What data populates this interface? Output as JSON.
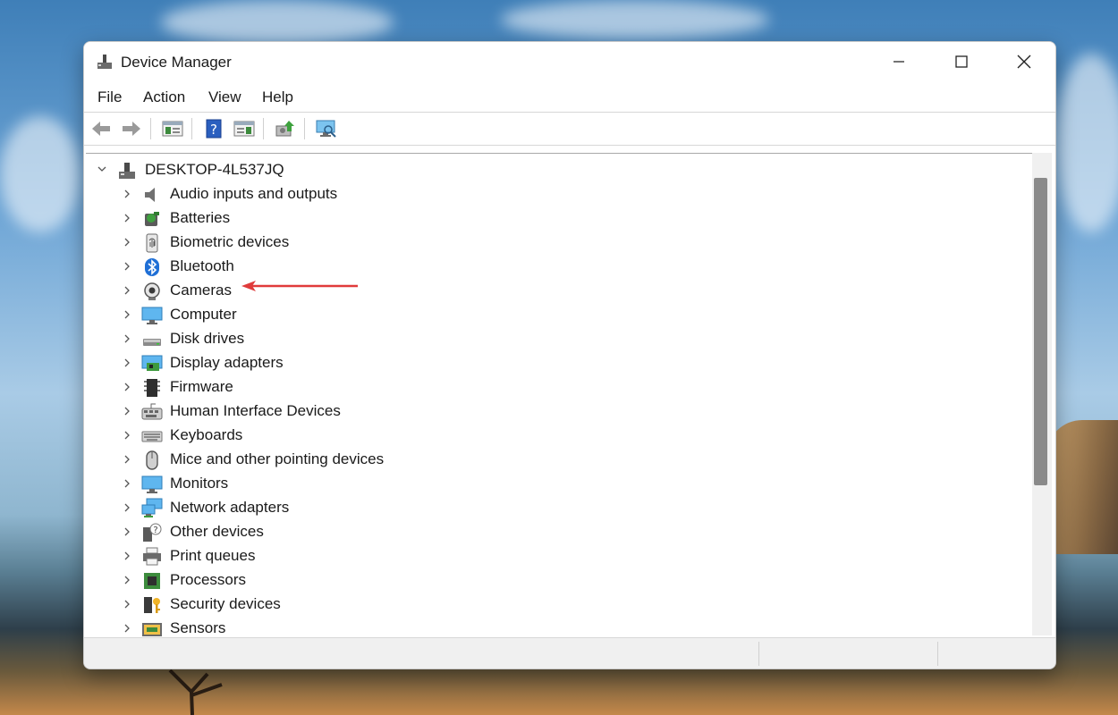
{
  "window": {
    "title": "Device Manager",
    "controls": {
      "minimize": "minimize-icon",
      "maximize": "maximize-icon",
      "close": "close-icon"
    }
  },
  "menu": [
    "File",
    "Action",
    "View",
    "Help"
  ],
  "toolbar": [
    "back-icon",
    "forward-icon",
    "properties-icon",
    "help-icon",
    "action-pane-icon",
    "update-driver-icon",
    "scan-hardware-icon"
  ],
  "tree": {
    "root": "DESKTOP-4L537JQ",
    "items": [
      {
        "label": "Audio inputs and outputs",
        "icon": "speaker-icon"
      },
      {
        "label": "Batteries",
        "icon": "battery-icon"
      },
      {
        "label": "Biometric devices",
        "icon": "fingerprint-icon"
      },
      {
        "label": "Bluetooth",
        "icon": "bluetooth-icon"
      },
      {
        "label": "Cameras",
        "icon": "camera-icon"
      },
      {
        "label": "Computer",
        "icon": "computer-icon"
      },
      {
        "label": "Disk drives",
        "icon": "disk-drive-icon"
      },
      {
        "label": "Display adapters",
        "icon": "display-adapter-icon"
      },
      {
        "label": "Firmware",
        "icon": "firmware-icon"
      },
      {
        "label": "Human Interface Devices",
        "icon": "hid-icon"
      },
      {
        "label": "Keyboards",
        "icon": "keyboard-icon"
      },
      {
        "label": "Mice and other pointing devices",
        "icon": "mouse-icon"
      },
      {
        "label": "Monitors",
        "icon": "monitor-icon"
      },
      {
        "label": "Network adapters",
        "icon": "network-icon"
      },
      {
        "label": "Other devices",
        "icon": "unknown-device-icon"
      },
      {
        "label": "Print queues",
        "icon": "printer-icon"
      },
      {
        "label": "Processors",
        "icon": "processor-icon"
      },
      {
        "label": "Security devices",
        "icon": "security-device-icon"
      },
      {
        "label": "Sensors",
        "icon": "sensor-icon"
      }
    ]
  },
  "annotation": {
    "color": "#e03b3b",
    "target": "Cameras"
  }
}
